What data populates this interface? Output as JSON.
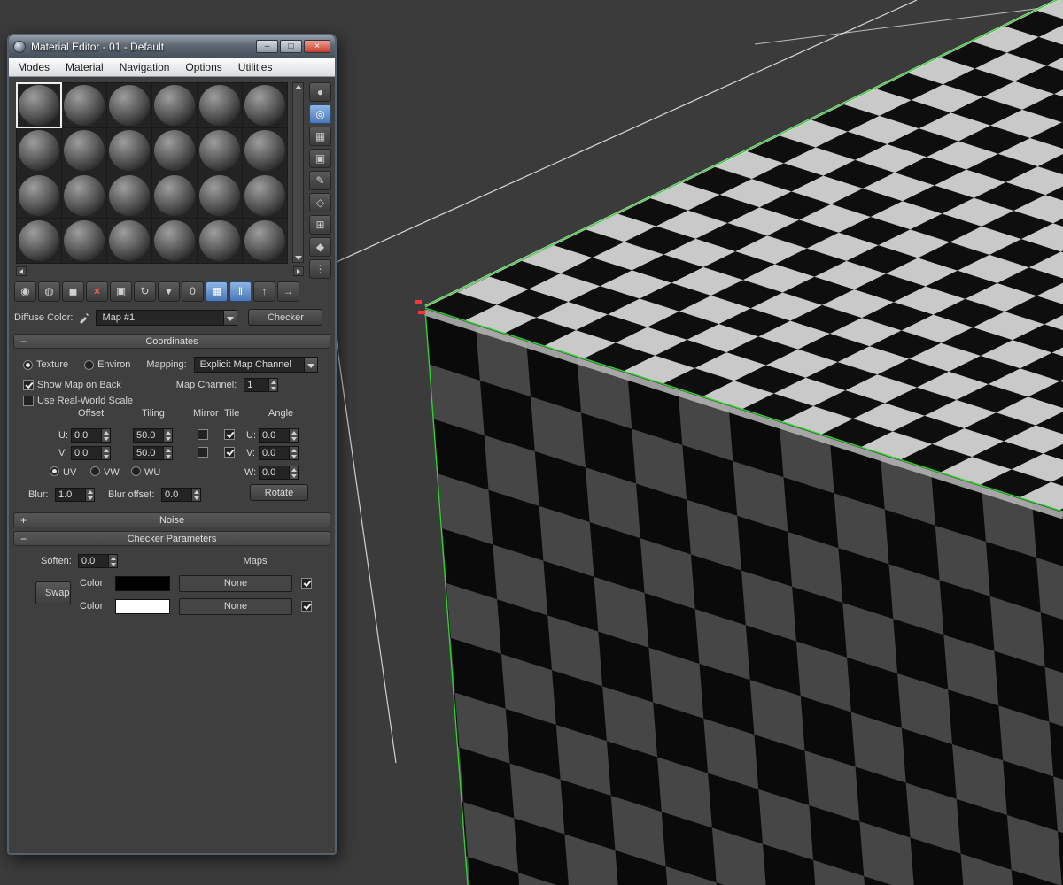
{
  "window": {
    "title": "Material Editor - 01 - Default",
    "menu": [
      "Modes",
      "Material",
      "Navigation",
      "Options",
      "Utilities"
    ],
    "buttons": {
      "minimize": "–",
      "maximize": "□",
      "close": "×"
    }
  },
  "side_toolbar": [
    {
      "name": "sample-type",
      "glyph": "●"
    },
    {
      "name": "magnify",
      "glyph": "◎"
    },
    {
      "name": "background",
      "glyph": "▦"
    },
    {
      "name": "sample-uv-tiling",
      "glyph": "▣"
    },
    {
      "name": "video-color-check",
      "glyph": "✎"
    },
    {
      "name": "make-preview",
      "glyph": "◇"
    },
    {
      "name": "options",
      "glyph": "⊞"
    },
    {
      "name": "select-by-material",
      "glyph": "◆"
    },
    {
      "name": "material-map-navigator",
      "glyph": "⋮"
    }
  ],
  "main_toolbar": [
    {
      "name": "get-material",
      "glyph": "◉"
    },
    {
      "name": "put-material-to-scene",
      "glyph": "◍"
    },
    {
      "name": "assign-material-to-selection",
      "glyph": "◼"
    },
    {
      "name": "reset-map",
      "glyph": "×"
    },
    {
      "name": "make-material-copy",
      "glyph": "▣"
    },
    {
      "name": "make-unique",
      "glyph": "↻"
    },
    {
      "name": "put-to-library",
      "glyph": "▼"
    },
    {
      "name": "material-id-channel",
      "glyph": "0"
    },
    {
      "name": "show-map-in-viewport",
      "glyph": "▦"
    },
    {
      "name": "show-end-result",
      "glyph": "‖"
    },
    {
      "name": "go-to-parent",
      "glyph": "↑"
    },
    {
      "name": "go-forward-to-sibling",
      "glyph": "→"
    }
  ],
  "material": {
    "channel_label": "Diffuse Color:",
    "map_name": "Map #1",
    "type_button": "Checker"
  },
  "rollouts": {
    "minus": "−",
    "plus": "+"
  },
  "coordinates": {
    "title": "Coordinates",
    "texture": "Texture",
    "environ": "Environ",
    "mapping_label": "Mapping:",
    "mapping_value": "Explicit Map Channel",
    "show_map_on_back": "Show Map on Back",
    "map_channel_label": "Map Channel:",
    "map_channel": "1",
    "use_real_world_scale": "Use Real-World Scale",
    "col_offset": "Offset",
    "col_tiling": "Tiling",
    "col_mirror": "Mirror",
    "col_tile": "Tile",
    "col_angle": "Angle",
    "u_label": "U:",
    "v_label": "V:",
    "w_label": "W:",
    "offset_u": "0.0",
    "offset_v": "0.0",
    "tiling_u": "50.0",
    "tiling_v": "50.0",
    "angle_u": "0.0",
    "angle_v": "0.0",
    "angle_w": "0.0",
    "uv": "UV",
    "vw": "VW",
    "wu": "WU",
    "blur_label": "Blur:",
    "blur": "1.0",
    "blur_offset_label": "Blur offset:",
    "blur_offset": "0.0",
    "rotate": "Rotate"
  },
  "noise": {
    "title": "Noise"
  },
  "checker_params": {
    "title": "Checker Parameters",
    "soften_label": "Soften:",
    "soften": "0.0",
    "maps_label": "Maps",
    "swap": "Swap",
    "color1_label": "Color",
    "color2_label": "Color",
    "none1": "None",
    "none2": "None",
    "color1": "#000000",
    "color2": "#ffffff"
  },
  "viewport": {
    "bg": "#3b3b3b",
    "grid_line_color": "#e9e9e9",
    "edge_color": "#2ed32e",
    "vertex_color": "#ff3434",
    "bevel_color": "#b9b9b9",
    "top_face": {
      "light": "#c9c9c9",
      "dark": "#0e0e0e"
    },
    "front_face": {
      "light": "#464646",
      "dark": "#0a0a0a"
    }
  }
}
